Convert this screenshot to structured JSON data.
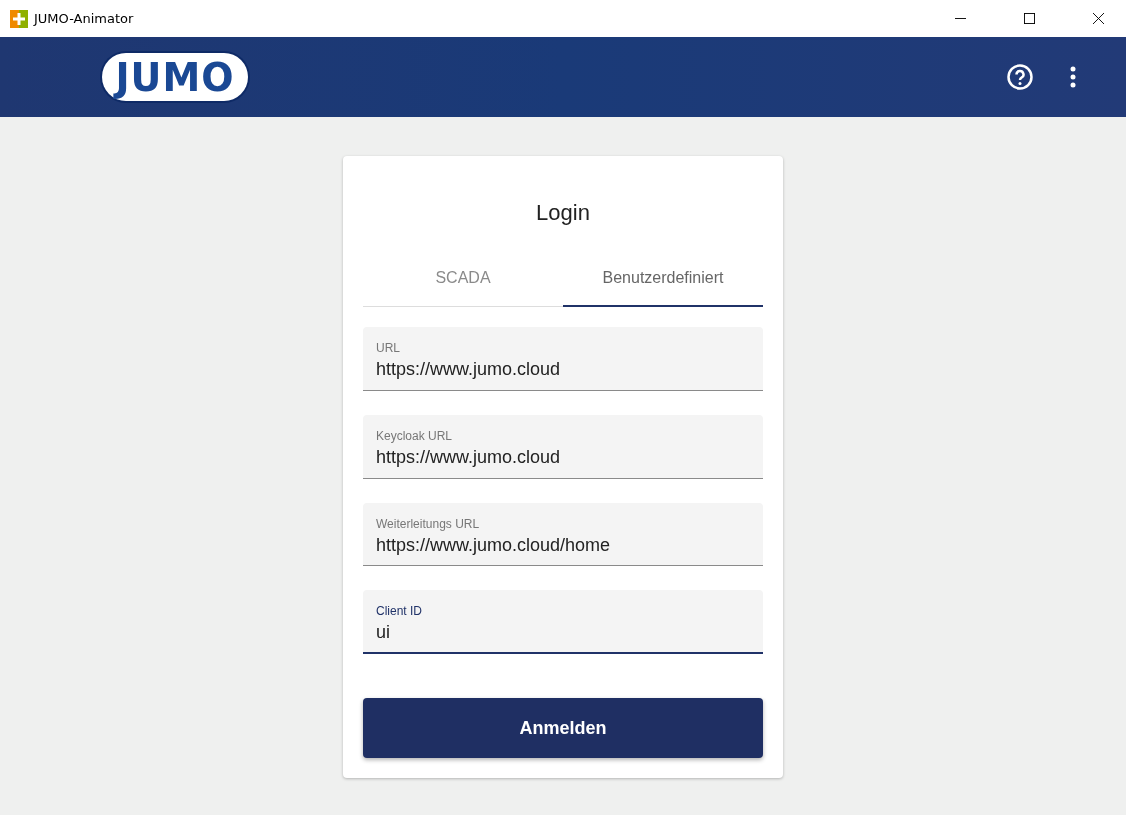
{
  "window": {
    "title": "JUMO-Animator"
  },
  "header": {
    "logo": "JUMO"
  },
  "login": {
    "title": "Login",
    "tabs": [
      {
        "label": "SCADA",
        "selected": false
      },
      {
        "label": "Benutzerdefiniert",
        "selected": true
      }
    ],
    "fields": [
      {
        "label": "URL",
        "value": "https://www.jumo.cloud",
        "focused": false
      },
      {
        "label": "Keycloak URL",
        "value": "https://www.jumo.cloud",
        "focused": false
      },
      {
        "label": "Weiterleitungs URL",
        "value": "https://www.jumo.cloud/home",
        "focused": false
      },
      {
        "label": "Client ID",
        "value": "ui",
        "focused": true
      }
    ],
    "button": "Anmelden"
  }
}
